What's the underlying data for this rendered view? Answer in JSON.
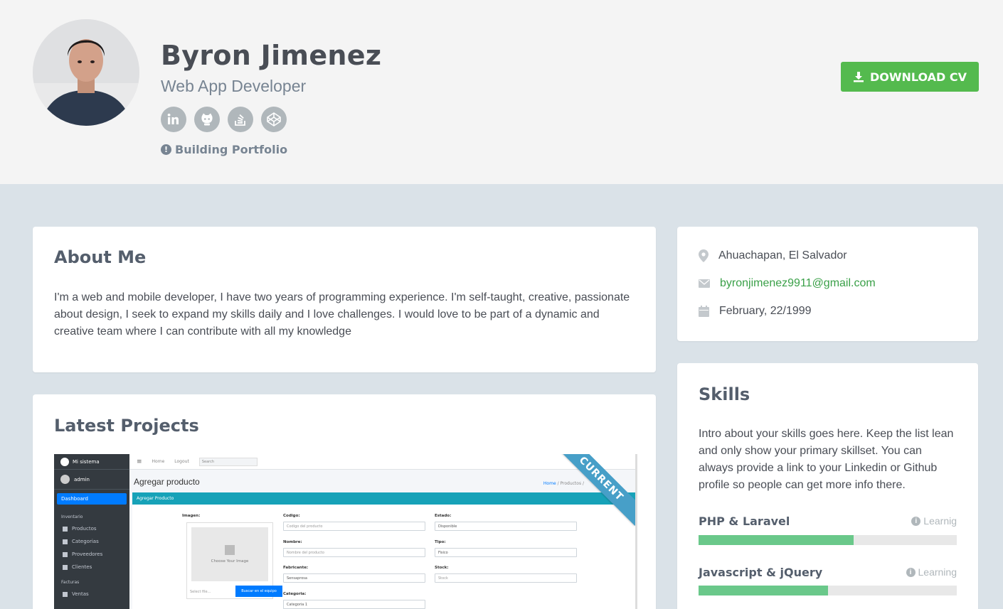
{
  "profile": {
    "name": "Byron Jimenez",
    "title": "Web App Developer",
    "status": "Building Portfolio",
    "download_label": "DOWNLOAD CV",
    "social": [
      "linkedin-icon",
      "github-icon",
      "stack-overflow-icon",
      "codepen-icon"
    ]
  },
  "about": {
    "heading": "About Me",
    "text": "I'm a web and mobile developer, I have two years of programming experience. I'm self-taught, creative, passionate about design, I seek to expand my skills daily and I love challenges. I would love to be part of a dynamic and creative team where I can contribute with all my knowledge"
  },
  "projects": {
    "heading": "Latest Projects",
    "ribbon": "CURRENT",
    "screenshot": {
      "brand": "Mi sistema",
      "user": "admin",
      "dashboard": "Dashboard",
      "section_inventory": "Inventario",
      "menu": [
        "Productos",
        "Categorias",
        "Proveedores",
        "Clientes"
      ],
      "section_sales": "Facturas",
      "sales_item": "Ventas",
      "nav": [
        "Home",
        "Logout"
      ],
      "search_placeholder": "Search",
      "page_title": "Agregar producto",
      "crumb_home": "Home",
      "crumb_rest": "/ Productos /",
      "form_header": "Agregar Producto",
      "labels": {
        "imagen": "Imagen:",
        "codigo": "Codigo:",
        "estado": "Estado:",
        "nombre": "Nombre:",
        "tipo": "Tipo:",
        "fabricante": "Fabricante:",
        "stock": "Stock:",
        "categoria": "Categoria:"
      },
      "values": {
        "codigo": "Codigo del producto",
        "estado": "Disponible",
        "nombre": "Nombre del producto",
        "tipo": "Fisico",
        "fabricante": "Sensaprosa",
        "stock": "Stock",
        "categoria": "Categoria 1"
      },
      "image_choose": "Choose Your Image",
      "image_select": "Select file...",
      "image_button": "Buscar en el equipo"
    }
  },
  "info": {
    "location": "Ahuachapan, El Salvador",
    "email": "byronjimenez9911@gmail.com",
    "birthday": "February, 22/1999"
  },
  "skills": {
    "heading": "Skills",
    "intro": "Intro about your skills goes here. Keep the list lean and only show your primary skillset. You can always provide a link to your Linkedin or Github profile so people can get more info there.",
    "items": [
      {
        "name": "PHP & Laravel",
        "level": "Learnig",
        "percent": 60
      },
      {
        "name": "Javascript & jQuery",
        "level": "Learning",
        "percent": 50
      }
    ]
  },
  "colors": {
    "accent_green": "#54ba4e",
    "bar_fill": "#6ac88a",
    "ribbon": "#479fc8",
    "background": "#dae2e8"
  }
}
